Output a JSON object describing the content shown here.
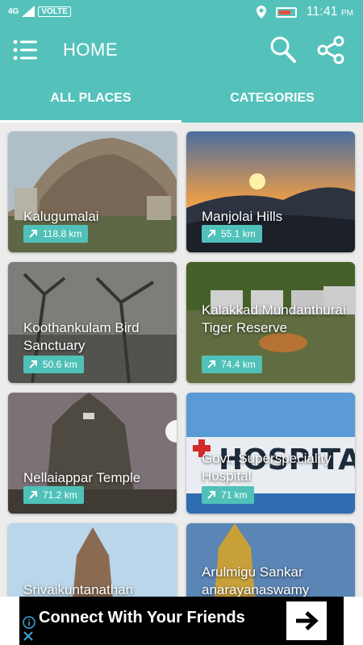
{
  "status": {
    "network": "4G",
    "volte": "VOLTE",
    "time": "11:41",
    "ampm": "PM"
  },
  "header": {
    "title": "HOME",
    "menu_icon": "list-menu-icon",
    "search_icon": "search-icon",
    "share_icon": "share-icon"
  },
  "tabs": [
    {
      "label": "ALL PLACES",
      "active": true
    },
    {
      "label": "CATEGORIES",
      "active": false
    }
  ],
  "places": [
    {
      "name": "Kalugumalai",
      "distance": "118.8 km"
    },
    {
      "name": "Manjolai Hills",
      "distance": "55.1 km"
    },
    {
      "name": "Koothankulam Bird Sanctuary",
      "distance": "50.6 km"
    },
    {
      "name": "Kalakkad Mundanthurai Tiger Reserve",
      "distance": "74.4 km"
    },
    {
      "name": "Nellaiappar Temple",
      "distance": "71.2 km"
    },
    {
      "name": "Govt. Superspeciality Hospital",
      "distance": "71 km"
    },
    {
      "name": "Srivaikuntanathan",
      "distance": ""
    },
    {
      "name": "Arulmigu Sankar anarayanaswamy",
      "distance": ""
    }
  ],
  "ad": {
    "text": "Connect With Your Friends"
  },
  "colors": {
    "primary": "#54c2bb",
    "badge": "#4fc1b9"
  }
}
